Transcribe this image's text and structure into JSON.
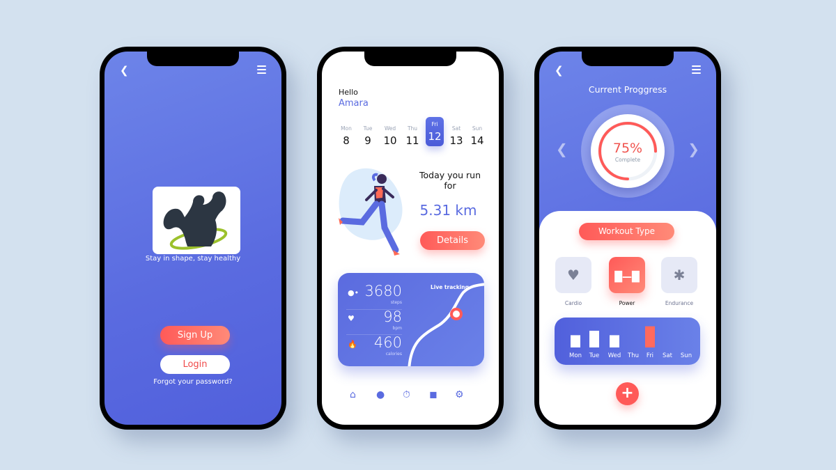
{
  "colors": {
    "primary": "#5a6be0",
    "accent": "#ff5a58",
    "background": "#d3e1ef"
  },
  "welcome": {
    "back_icon": "chevron-left-icon",
    "menu_icon": "hamburger-menu-icon",
    "logo": "bodybuilder-logo",
    "tagline": "Stay in shape, stay healthy",
    "signup_label": "Sign Up",
    "login_label": "Login",
    "forgot_label": "Forgot your password?"
  },
  "dashboard": {
    "greeting": "Hello",
    "user_name": "Amara",
    "days": [
      {
        "name": "Mon",
        "date": "8"
      },
      {
        "name": "Tue",
        "date": "9"
      },
      {
        "name": "Wed",
        "date": "10"
      },
      {
        "name": "Thu",
        "date": "11"
      },
      {
        "name": "Fri",
        "date": "12",
        "selected": true
      },
      {
        "name": "Sat",
        "date": "13"
      },
      {
        "name": "Sun",
        "date": "14"
      }
    ],
    "run_title": "Today you run for",
    "run_distance": "5.31 km",
    "details_label": "Details",
    "live_tracking_label": "Live tracking",
    "stats": [
      {
        "icon": "footsteps-icon",
        "value": "3680",
        "unit": "steps"
      },
      {
        "icon": "heart-icon",
        "value": "98",
        "unit": "bpm"
      },
      {
        "icon": "flame-icon",
        "value": "460",
        "unit": "calories"
      }
    ],
    "nav": [
      "home-icon",
      "profile-icon",
      "stopwatch-icon",
      "notification-icon",
      "settings-icon"
    ]
  },
  "progress": {
    "title": "Current Proggress",
    "percent": 75,
    "percent_label": "75%",
    "complete_label": "Complete",
    "workout_type_label": "Workout Type",
    "workouts": [
      {
        "label": "Cardio",
        "icon": "heart-pulse-icon"
      },
      {
        "label": "Power",
        "icon": "dumbbell-icon",
        "active": true
      },
      {
        "label": "Endurance",
        "icon": "runner-icon"
      }
    ],
    "week_chart": {
      "days": [
        "Mon",
        "Tue",
        "Wed",
        "Thu",
        "Fri",
        "Sat",
        "Sun"
      ],
      "values": [
        0.55,
        0.75,
        0.55,
        0,
        0.95,
        0,
        0
      ],
      "highlight": "Fri"
    }
  }
}
